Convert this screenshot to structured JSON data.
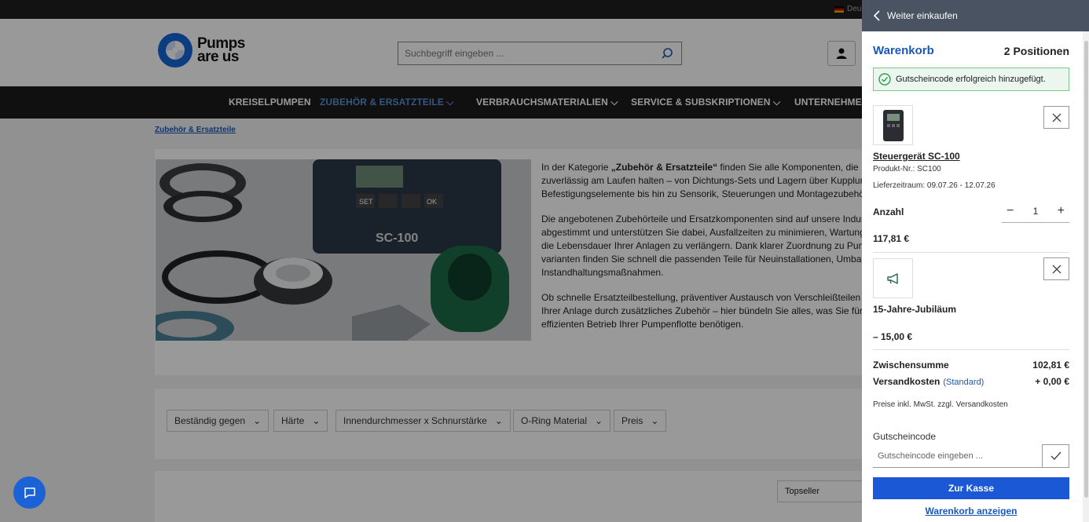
{
  "topbar": {
    "language": "Deu"
  },
  "header": {
    "logo_line1": "Pumps",
    "logo_line2": "are us",
    "search_placeholder": "Suchbegriff eingeben ..."
  },
  "nav": {
    "items": [
      "KREISELPUMPEN",
      "ZUBEHÖR & ERSATZTEILE ⌵",
      "VERBRAUCHSMATERIALIEN ⌵",
      "SERVICE & SUBSKRIPTIONEN ⌵",
      "UNTERNEHMEN"
    ]
  },
  "breadcrumb": "Zubehör & Ersatzteile",
  "category": {
    "image_label_device": "SC-100",
    "image_label_set": "SET",
    "image_label_ok": "OK",
    "p1_prefix": "In der Kategorie ",
    "p1_bold": "„Zubehör & Ersatzteile“",
    "p1_suffix": " finden Sie alle Komponenten, die Ihre P",
    "p1_line2": "zuverlässig am Laufen halten – von Dichtungs-Sets und Lagern über Kupplunge",
    "p1_line3": "Befestigungselemente bis hin zu Sensorik, Steuerungen und Montagezubehör.",
    "p2_line1": "Die angebotenen Zubehörteile und Ersatzkomponenten sind auf unsere Industri",
    "p2_line2": "abgestimmt und unterstützen Sie dabei, Ausfallzeiten zu minimieren, Wartunger",
    "p2_line3": "die Lebensdauer Ihrer Anlagen zu verlängern. Dank klarer Zuordnung zu Pumper",
    "p2_line4": "varianten finden Sie schnell die passenden Teile für Neuinstallationen, Umbaute",
    "p2_line5": "Instandhaltungsmaßnahmen.",
    "p3_line1": "Ob schnelle Ersatzteilbestellung, präventiver Austausch von Verschleißteilen od",
    "p3_line2": "Ihrer Anlage durch zusätzliches Zubehör – hier bündeln Sie alles, was Sie für ein",
    "p3_line3": "effizienten Betrieb Ihrer Pumpenflotte benötigen."
  },
  "filters": [
    "Beständig gegen",
    "Härte",
    "Innendurchmesser x Schnurstärke",
    "O-Ring Material",
    "Preis"
  ],
  "sort": {
    "label": "Topseller"
  },
  "cart": {
    "back_label": "Weiter einkaufen",
    "title": "Warenkorb",
    "count": "2 Positionen",
    "alert": "Gutscheincode erfolgreich hinzugefügt.",
    "item1": {
      "name": "Steuergerät SC-100",
      "product_no": "Produkt-Nr.: SC100",
      "delivery": "Lieferzeitraum: 09.07.26 - 12.07.26",
      "qty_label": "Anzahl",
      "qty": "1",
      "price": "117,81 €"
    },
    "item2": {
      "name": "15-Jahre-Jubiläum",
      "price": "– 15,00 €"
    },
    "subtotal_label": "Zwischensumme",
    "subtotal": "102,81 €",
    "shipping_label": "Versandkosten",
    "shipping_std": "(Standard)",
    "shipping": "+ 0,00 €",
    "tax_note": "Preise inkl. MwSt. zzgl. Versandkosten",
    "voucher_label": "Gutscheincode",
    "voucher_placeholder": "Gutscheincode eingeben ...",
    "checkout_label": "Zur Kasse",
    "show_cart_label": "Warenkorb anzeigen"
  },
  "colors": {
    "brand_blue": "#1a58d6",
    "nav_bg": "#1b1b1b",
    "success": "#2e9e4f"
  }
}
